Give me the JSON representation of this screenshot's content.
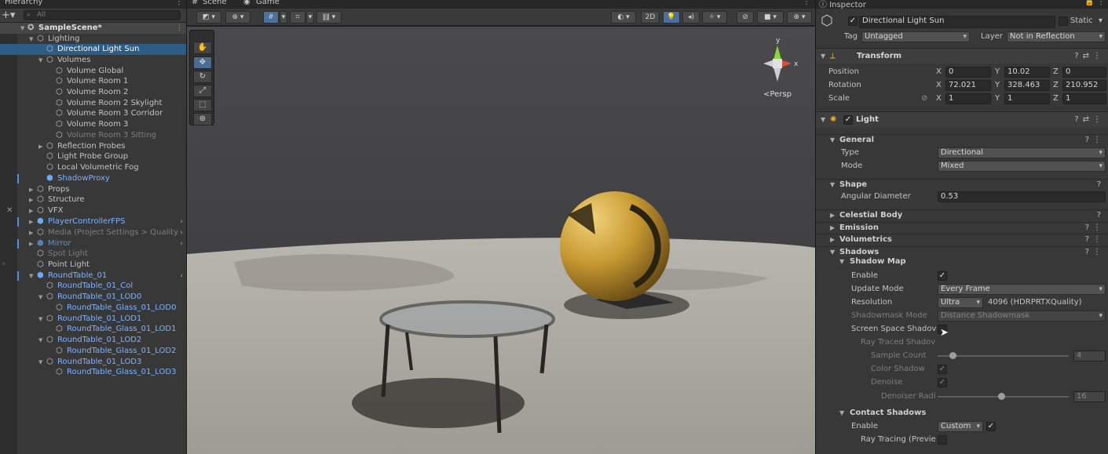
{
  "hierarchy": {
    "tab_label": "Hierarchy",
    "search_placeholder": "All",
    "scene_name": "SampleScene*",
    "rows": [
      {
        "label": "Lighting"
      },
      {
        "label": "Directional Light Sun"
      },
      {
        "label": "Volumes"
      },
      {
        "label": "Volume Global"
      },
      {
        "label": "Volume Room 1"
      },
      {
        "label": "Volume Room 2"
      },
      {
        "label": "Volume Room 2 Skylight"
      },
      {
        "label": "Volume Room 3 Corridor"
      },
      {
        "label": "Volume Room 3"
      },
      {
        "label": "Volume Room 3 Sitting"
      },
      {
        "label": "Reflection Probes"
      },
      {
        "label": "Light Probe Group"
      },
      {
        "label": "Local Volumetric Fog"
      },
      {
        "label": "ShadowProxy"
      },
      {
        "label": "Props"
      },
      {
        "label": "Structure"
      },
      {
        "label": "VFX"
      },
      {
        "label": "PlayerControllerFPS"
      },
      {
        "label": "Media (Project Settings > Quality"
      },
      {
        "label": "Mirror"
      },
      {
        "label": "Spot Light"
      },
      {
        "label": "Point Light"
      },
      {
        "label": "RoundTable_01"
      },
      {
        "label": "RoundTable_01_Col"
      },
      {
        "label": "RoundTable_01_LOD0"
      },
      {
        "label": "RoundTable_Glass_01_LOD0"
      },
      {
        "label": "RoundTable_01_LOD1"
      },
      {
        "label": "RoundTable_Glass_01_LOD1"
      },
      {
        "label": "RoundTable_01_LOD2"
      },
      {
        "label": "RoundTable_Glass_01_LOD2"
      },
      {
        "label": "RoundTable_01_LOD3"
      },
      {
        "label": "RoundTable_Glass_01_LOD3"
      }
    ]
  },
  "scene": {
    "tab_scene": "Scene",
    "tab_game": "Game",
    "btn_2d": "2D",
    "persp_label": "<Persp",
    "gizmo_y": "y",
    "gizmo_x": "x"
  },
  "inspector": {
    "tab_label": "Inspector",
    "object_name": "Directional Light Sun",
    "static_label": "Static",
    "tag_label": "Tag",
    "tag_value": "Untagged",
    "layer_label": "Layer",
    "layer_value": "Not in Reflection",
    "transform": {
      "title": "Transform",
      "position_label": "Position",
      "rotation_label": "Rotation",
      "scale_label": "Scale",
      "x": "X",
      "y": "Y",
      "z": "Z",
      "position": [
        "0",
        "10.02",
        "0"
      ],
      "rotation": [
        "72.021",
        "328.463",
        "210.952"
      ],
      "scale": [
        "1",
        "1",
        "1"
      ]
    },
    "light": {
      "title": "Light",
      "general": "General",
      "type_label": "Type",
      "type_value": "Directional",
      "mode_label": "Mode",
      "mode_value": "Mixed",
      "shape": "Shape",
      "angular_label": "Angular Diameter",
      "angular_value": "0.53",
      "celestial": "Celestial Body",
      "emission": "Emission",
      "volumetrics": "Volumetrics",
      "shadows": "Shadows",
      "shadow_map": "Shadow Map",
      "enable_label": "Enable",
      "update_label": "Update Mode",
      "update_value": "Every Frame",
      "resolution_label": "Resolution",
      "resolution_value": "Ultra",
      "resolution_info": "4096 (HDRPRTXQuality)",
      "shadowmask_label": "Shadowmask Mode",
      "shadowmask_value": "Distance Shadowmask",
      "screen_space_label": "Screen Space Shadov",
      "ray_traced_label": "Ray Traced Shadov",
      "sample_count_label": "Sample Count",
      "sample_count_value": "4",
      "color_shadow_label": "Color Shadow",
      "denoise_label": "Denoise",
      "denoiser_radius_label": "Denoiser Radi",
      "denoiser_radius_value": "16",
      "contact_shadows": "Contact Shadows",
      "contact_enable_label": "Enable",
      "contact_enable_value": "Custom",
      "ray_tracing_label": "Ray Tracing (Previe"
    }
  },
  "colors": {
    "selection": "#2c5d87",
    "prefab_blue": "#7fb3ff",
    "panel": "#383838"
  }
}
